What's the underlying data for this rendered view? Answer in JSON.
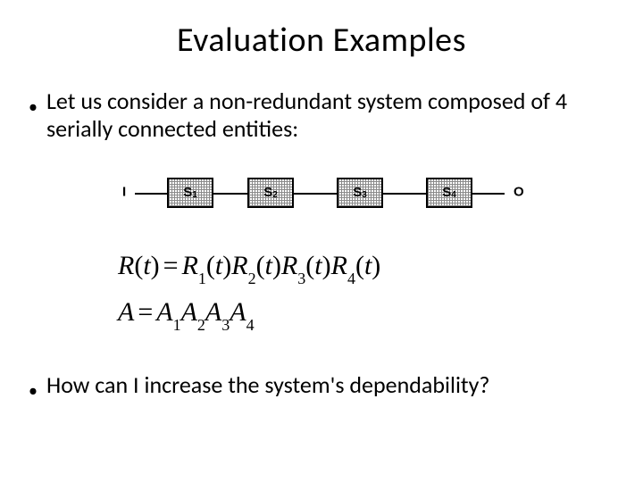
{
  "title": "Evaluation Examples",
  "bullet1": "Let us consider a non-redundant system composed of 4 serially connected entities:",
  "bullet2": "How can I increase the system's dependability?",
  "diagram": {
    "input": "I",
    "output": "O",
    "blocks": {
      "s1": "S",
      "s1sub": "1",
      "s2": "S",
      "s2sub": "2",
      "s3": "S",
      "s3sub": "3",
      "s4": "S",
      "s4sub": "4"
    }
  },
  "eq": {
    "R": "R",
    "t": "t",
    "eqs": "=",
    "R1": "R",
    "R2": "R",
    "R3": "R",
    "R4": "R",
    "n1": "1",
    "n2": "2",
    "n3": "3",
    "n4": "4",
    "A": "A",
    "A1": "A",
    "A2": "A",
    "A3": "A",
    "A4": "A"
  }
}
